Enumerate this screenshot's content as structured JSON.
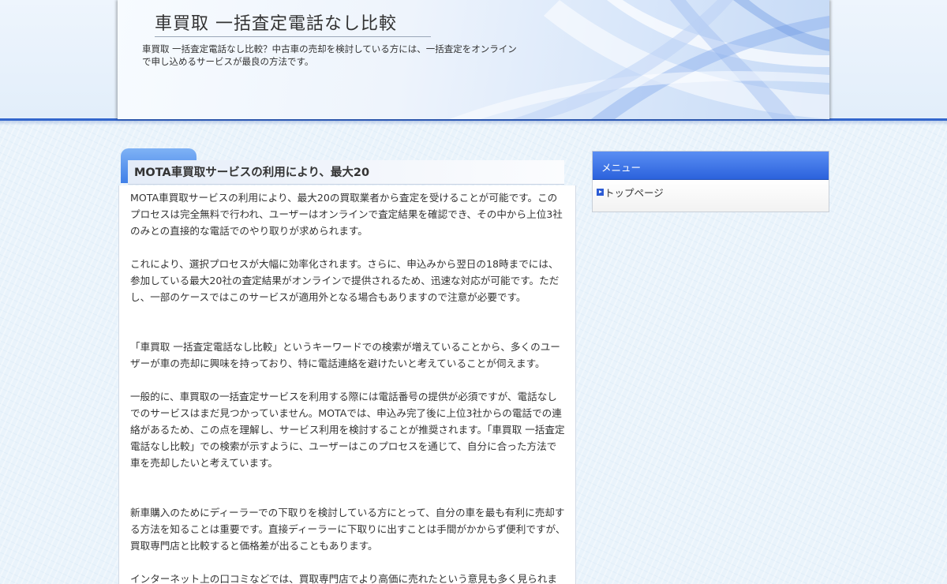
{
  "header": {
    "title": "車買取 一括査定電話なし比較",
    "description": "車買取 一括査定電話なし比較？中古車の売却を検討している方には、一括査定をオンラインで申し込めるサービスが最良の方法です。"
  },
  "article": {
    "title": "MOTA車買取サービスの利用により、最大20",
    "paragraphs": [
      "MOTA車買取サービスの利用により、最大20の買取業者から査定を受けることが可能です。このプロセスは完全無料で行われ、ユーザーはオンラインで査定結果を確認でき、その中から上位3社のみとの直接的な電話でのやり取りが求められます。",
      "これにより、選択プロセスが大幅に効率化されます。さらに、申込みから翌日の18時までには、参加している最大20社の査定結果がオンラインで提供されるため、迅速な対応が可能です。ただし、一部のケースではこのサービスが適用外となる場合もありますので注意が必要です。",
      "「車買取 一括査定電話なし比較」というキーワードでの検索が増えていることから、多くのユーザーが車の売却に興味を持っており、特に電話連絡を避けたいと考えていることが伺えます。",
      "一般的に、車買取の一括査定サービスを利用する際には電話番号の提供が必須ですが、電話なしでのサービスはまだ見つかっていません。MOTAでは、申込み完了後に上位3社からの電話での連絡があるため、この点を理解し、サービス利用を検討することが推奨されます。「車買取 一括査定電話なし比較」での検索が示すように、ユーザーはこのプロセスを通じて、自分に合った方法で車を売却したいと考えています。",
      "新車購入のためにディーラーでの下取りを検討している方にとって、自分の車を最も有利に売却する方法を知ることは重要です。直接ディーラーに下取りに出すことは手間がかからず便利ですが、買取専門店と比較すると価格差が出ることもあります。",
      "インターネット上の口コミなどでは、買取専門店でより高価に売れたという意見も多く見られま"
    ]
  },
  "sidebar": {
    "heading": "メニュー",
    "items": [
      {
        "label": "トップページ",
        "icon": "arrow-icon"
      }
    ]
  },
  "colors": {
    "accent": "#3366cc",
    "sidebar_header": "#3a6fe2",
    "text": "#333333"
  }
}
